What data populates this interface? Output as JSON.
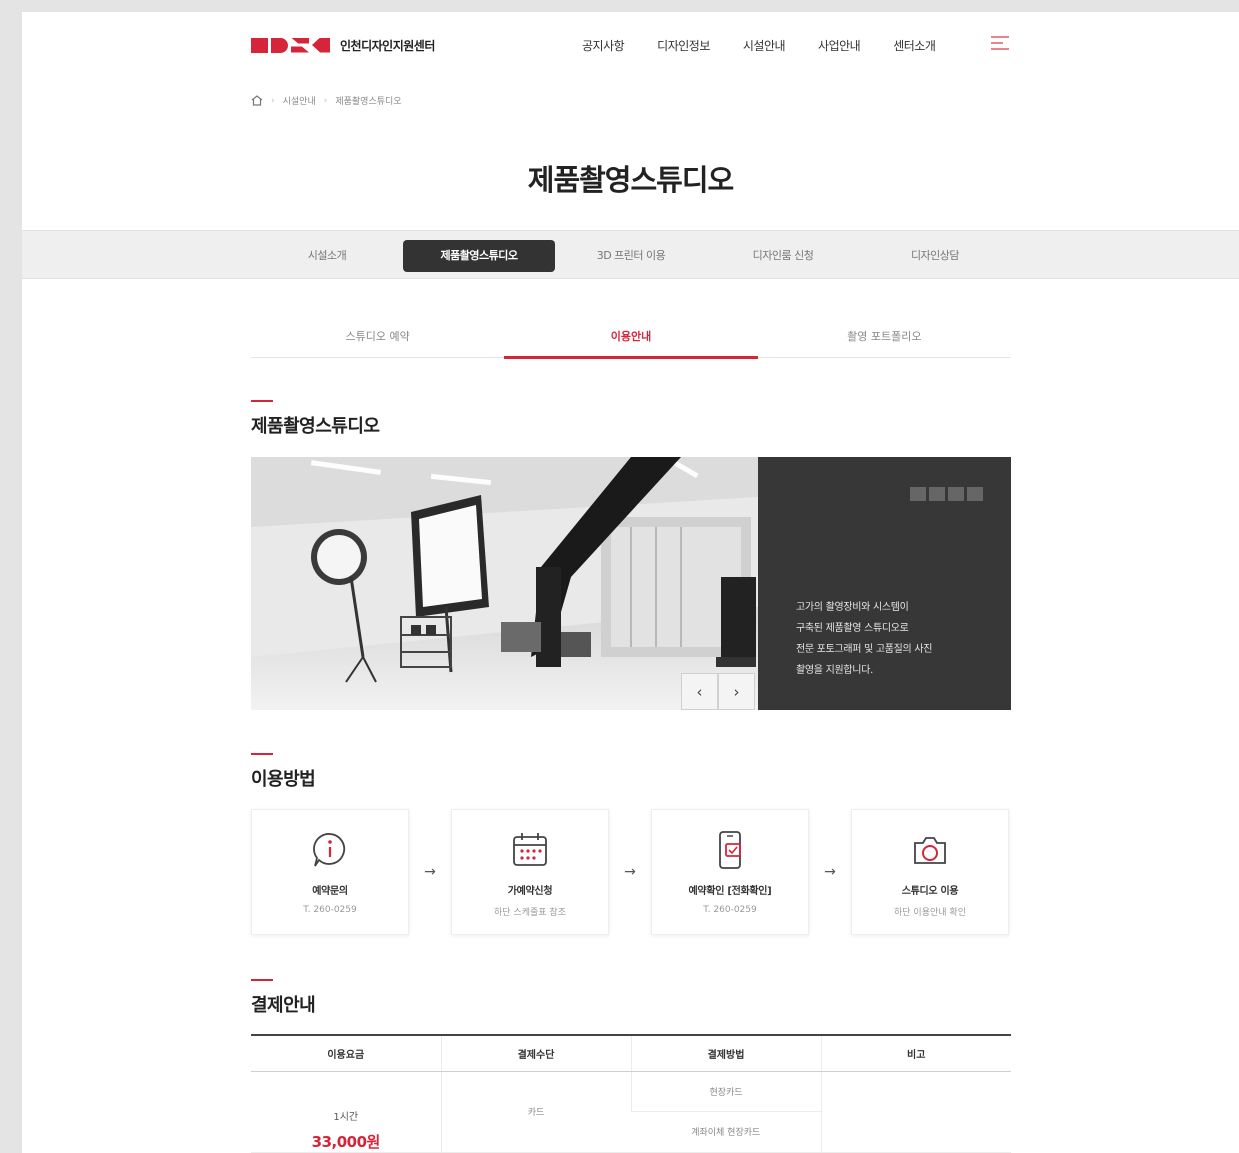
{
  "header": {
    "logo_text": "인천디자인지원센터",
    "nav": [
      "공지사항",
      "디자인정보",
      "시설안내",
      "사업안내",
      "센터소개"
    ]
  },
  "breadcrumb": [
    "시설안내",
    "제품촬영스튜디오"
  ],
  "page_title": "제품촬영스튜디오",
  "tabs": {
    "items": [
      "시설소개",
      "제품촬영스튜디오",
      "3D 프린터 이용",
      "디자인룸 신청",
      "디자인상담"
    ],
    "active_index": 1
  },
  "subtabs": {
    "items": [
      "스튜디오 예약",
      "이용안내",
      "촬영 포트폴리오"
    ],
    "active_index": 1
  },
  "sections": {
    "studio_title": "제품촬영스튜디오",
    "usage_title": "이용방법",
    "payment_title": "결제안내"
  },
  "hero": {
    "panel_lines": [
      "고가의 촬영장비와 시스템이",
      "구축된 제품촬영 스튜디오로",
      "전문 포토그래퍼 및 고품질의 사진",
      "촬영을 지원합니다."
    ],
    "prev_label": "‹",
    "next_label": "›"
  },
  "steps": [
    {
      "icon": "info-chat-icon",
      "title": "예약문의",
      "desc": "T. 260-0259"
    },
    {
      "icon": "calendar-icon",
      "title": "가예약신청",
      "desc": "하단 스케줄표 참조"
    },
    {
      "icon": "mobile-check-icon",
      "title": "예약확인 [전화확인]",
      "desc": "T. 260-0259"
    },
    {
      "icon": "camera-icon",
      "title": "스튜디오 이용",
      "desc": "하단 이용안내 확인"
    }
  ],
  "payment_table": {
    "headers": [
      "이용요금",
      "결제수단",
      "결제방법",
      "비고"
    ],
    "hours": "1시간",
    "price": "33,000원",
    "method": "카드",
    "ways": [
      "현장카드",
      "계좌이체 현장카드"
    ]
  },
  "colors": {
    "accent": "#d6253a",
    "dark_panel": "#373737",
    "active_tab": "#333333"
  }
}
